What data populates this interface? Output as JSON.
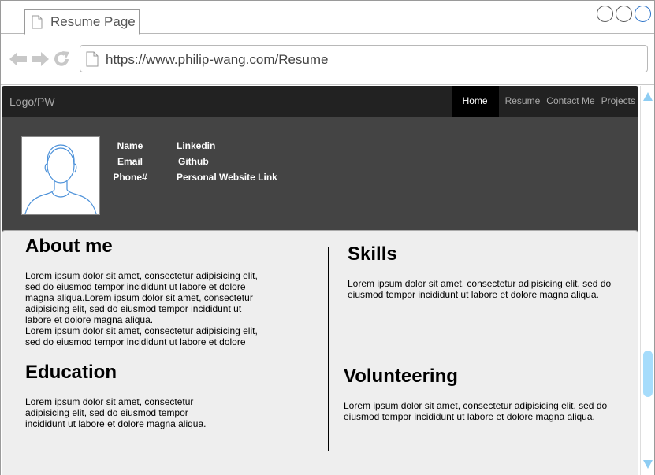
{
  "browser": {
    "tab_title": "Resume Page",
    "url": "https://www.philip-wang.com/Resume"
  },
  "site_nav": {
    "logo": "Logo/PW",
    "items": [
      {
        "label": "Home",
        "active": true
      },
      {
        "label": "Resume",
        "active": false
      },
      {
        "label": "Contact Me",
        "active": false
      },
      {
        "label": "Projects",
        "active": false
      }
    ]
  },
  "profile": {
    "labels": [
      "Name",
      "Email",
      "Phone#"
    ],
    "links": [
      "Linkedin",
      "Github",
      "Personal Website Link"
    ]
  },
  "sections": {
    "about": {
      "title": "About me",
      "lines": [
        "Lorem ipsum dolor sit amet, consectetur adipisicing elit,",
        "sed do eiusmod tempor incididunt ut labore et dolore",
        "magna aliqua.Lorem ipsum dolor sit amet, consectetur",
        "adipisicing elit, sed do eiusmod tempor incididunt ut",
        "labore et dolore magna aliqua.",
        "Lorem ipsum dolor sit amet, consectetur adipisicing elit,",
        "sed do eiusmod tempor incididunt ut labore et dolore"
      ]
    },
    "education": {
      "title": "Education",
      "lines": [
        "Lorem ipsum dolor sit amet, consectetur",
        "adipisicing elit, sed do eiusmod tempor",
        "incididunt ut labore et dolore magna aliqua."
      ]
    },
    "skills": {
      "title": "Skills",
      "lines": [
        "Lorem ipsum dolor sit amet, consectetur adipisicing elit, sed do",
        "eiusmod tempor incididunt ut labore et dolore magna aliqua."
      ]
    },
    "volunteering": {
      "title": "Volunteering",
      "lines": [
        "Lorem ipsum dolor sit amet, consectetur adipisicing elit, sed do",
        "eiusmod tempor incididunt ut labore et dolore magna aliqua."
      ]
    }
  },
  "icons": {
    "tab": "page-icon",
    "back": "back-arrow-icon",
    "forward": "forward-arrow-icon",
    "reload": "reload-icon",
    "url": "page-icon",
    "avatar": "user-avatar-icon"
  },
  "colors": {
    "site_nav_bg": "#222222",
    "hero_bg": "#444444",
    "content_bg": "#eeeeee",
    "scroll_accent": "#8ecdf3"
  }
}
